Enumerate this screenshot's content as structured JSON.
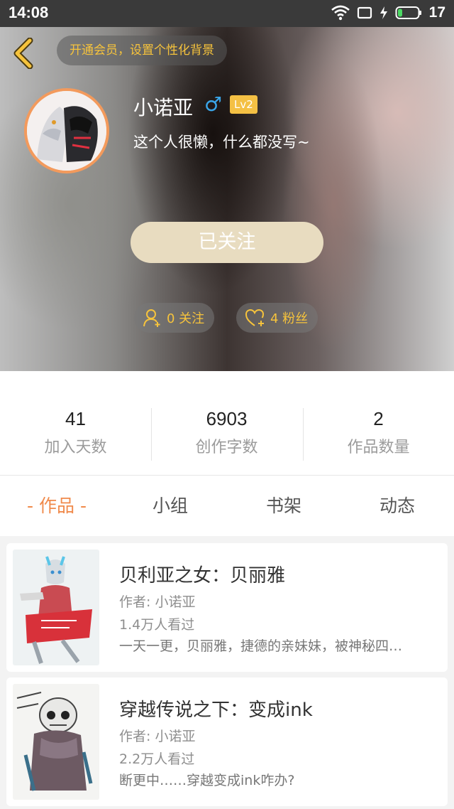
{
  "status_bar": {
    "time": "14:08",
    "battery": "17"
  },
  "header": {
    "vip_prompt": "开通会员，设置个性化背景",
    "username": "小诺亚",
    "gender_symbol": "♂",
    "level": "Lv2",
    "bio": "这个人很懒，什么都没写~",
    "follow_button": "已关注",
    "following_label": "0 关注",
    "fans_label": "4 粉丝"
  },
  "stats": [
    {
      "value": "41",
      "label": "加入天数"
    },
    {
      "value": "6903",
      "label": "创作字数"
    },
    {
      "value": "2",
      "label": "作品数量"
    }
  ],
  "tabs": [
    {
      "label": "- 作品 -",
      "active": true
    },
    {
      "label": "小组",
      "active": false
    },
    {
      "label": "书架",
      "active": false
    },
    {
      "label": "动态",
      "active": false
    }
  ],
  "works": [
    {
      "title": "贝利亚之女：贝丽雅",
      "author": "作者: 小诺亚",
      "views": "1.4万人看过",
      "description": "一天一更，贝丽雅，捷德的亲妹妹，被神秘四…"
    },
    {
      "title": "穿越传说之下：变成ink",
      "author": "作者: 小诺亚",
      "views": "2.2万人看过",
      "description": "断更中……穿越变成ink咋办?"
    }
  ],
  "colors": {
    "accent": "#f08a4b",
    "gold": "#f6c33c",
    "follow_btn": "#e8dcc0"
  }
}
